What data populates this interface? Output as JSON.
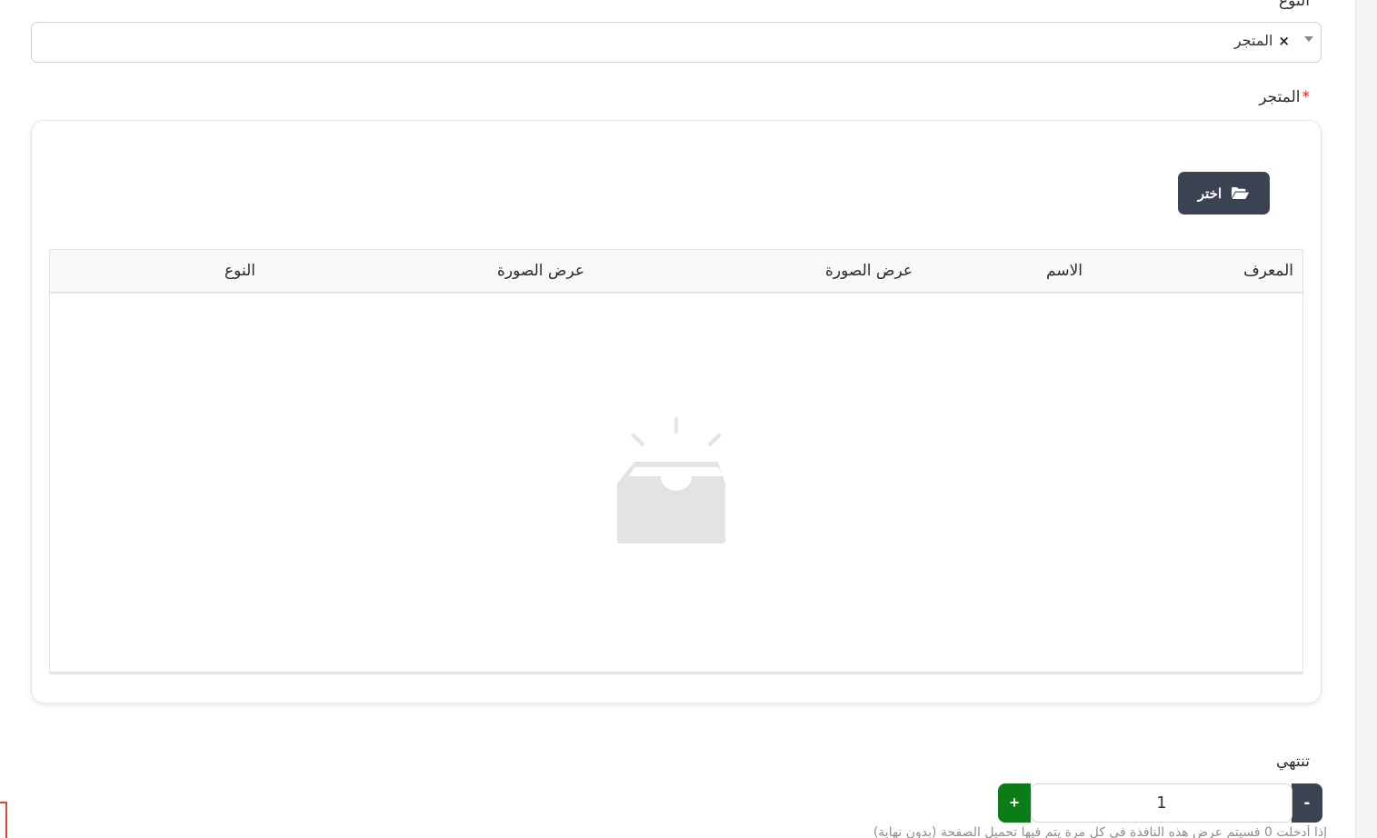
{
  "type_field": {
    "label": "النوع",
    "selected_chip": "المتجر",
    "chip_remove": "×"
  },
  "store_field": {
    "label": "المتجر",
    "required_mark": "*",
    "choose_button": "اختر",
    "table": {
      "columns": [
        "المعرف",
        "الاسم",
        "عرض الصورة",
        "عرض الصورة",
        "النوع"
      ],
      "rows": []
    }
  },
  "ends_field": {
    "label": "تنتهي",
    "minus": "-",
    "plus": "+",
    "value": "1",
    "hint": "إذا أدخلت 0 فسيتم عرض هذه النافذة في كل مرة يتم فيها تحميل الصفحة (بدون نهاية)"
  },
  "colors": {
    "dark_button": "#3b4252",
    "plus_button": "#0a7d16",
    "required": "#e02424"
  }
}
